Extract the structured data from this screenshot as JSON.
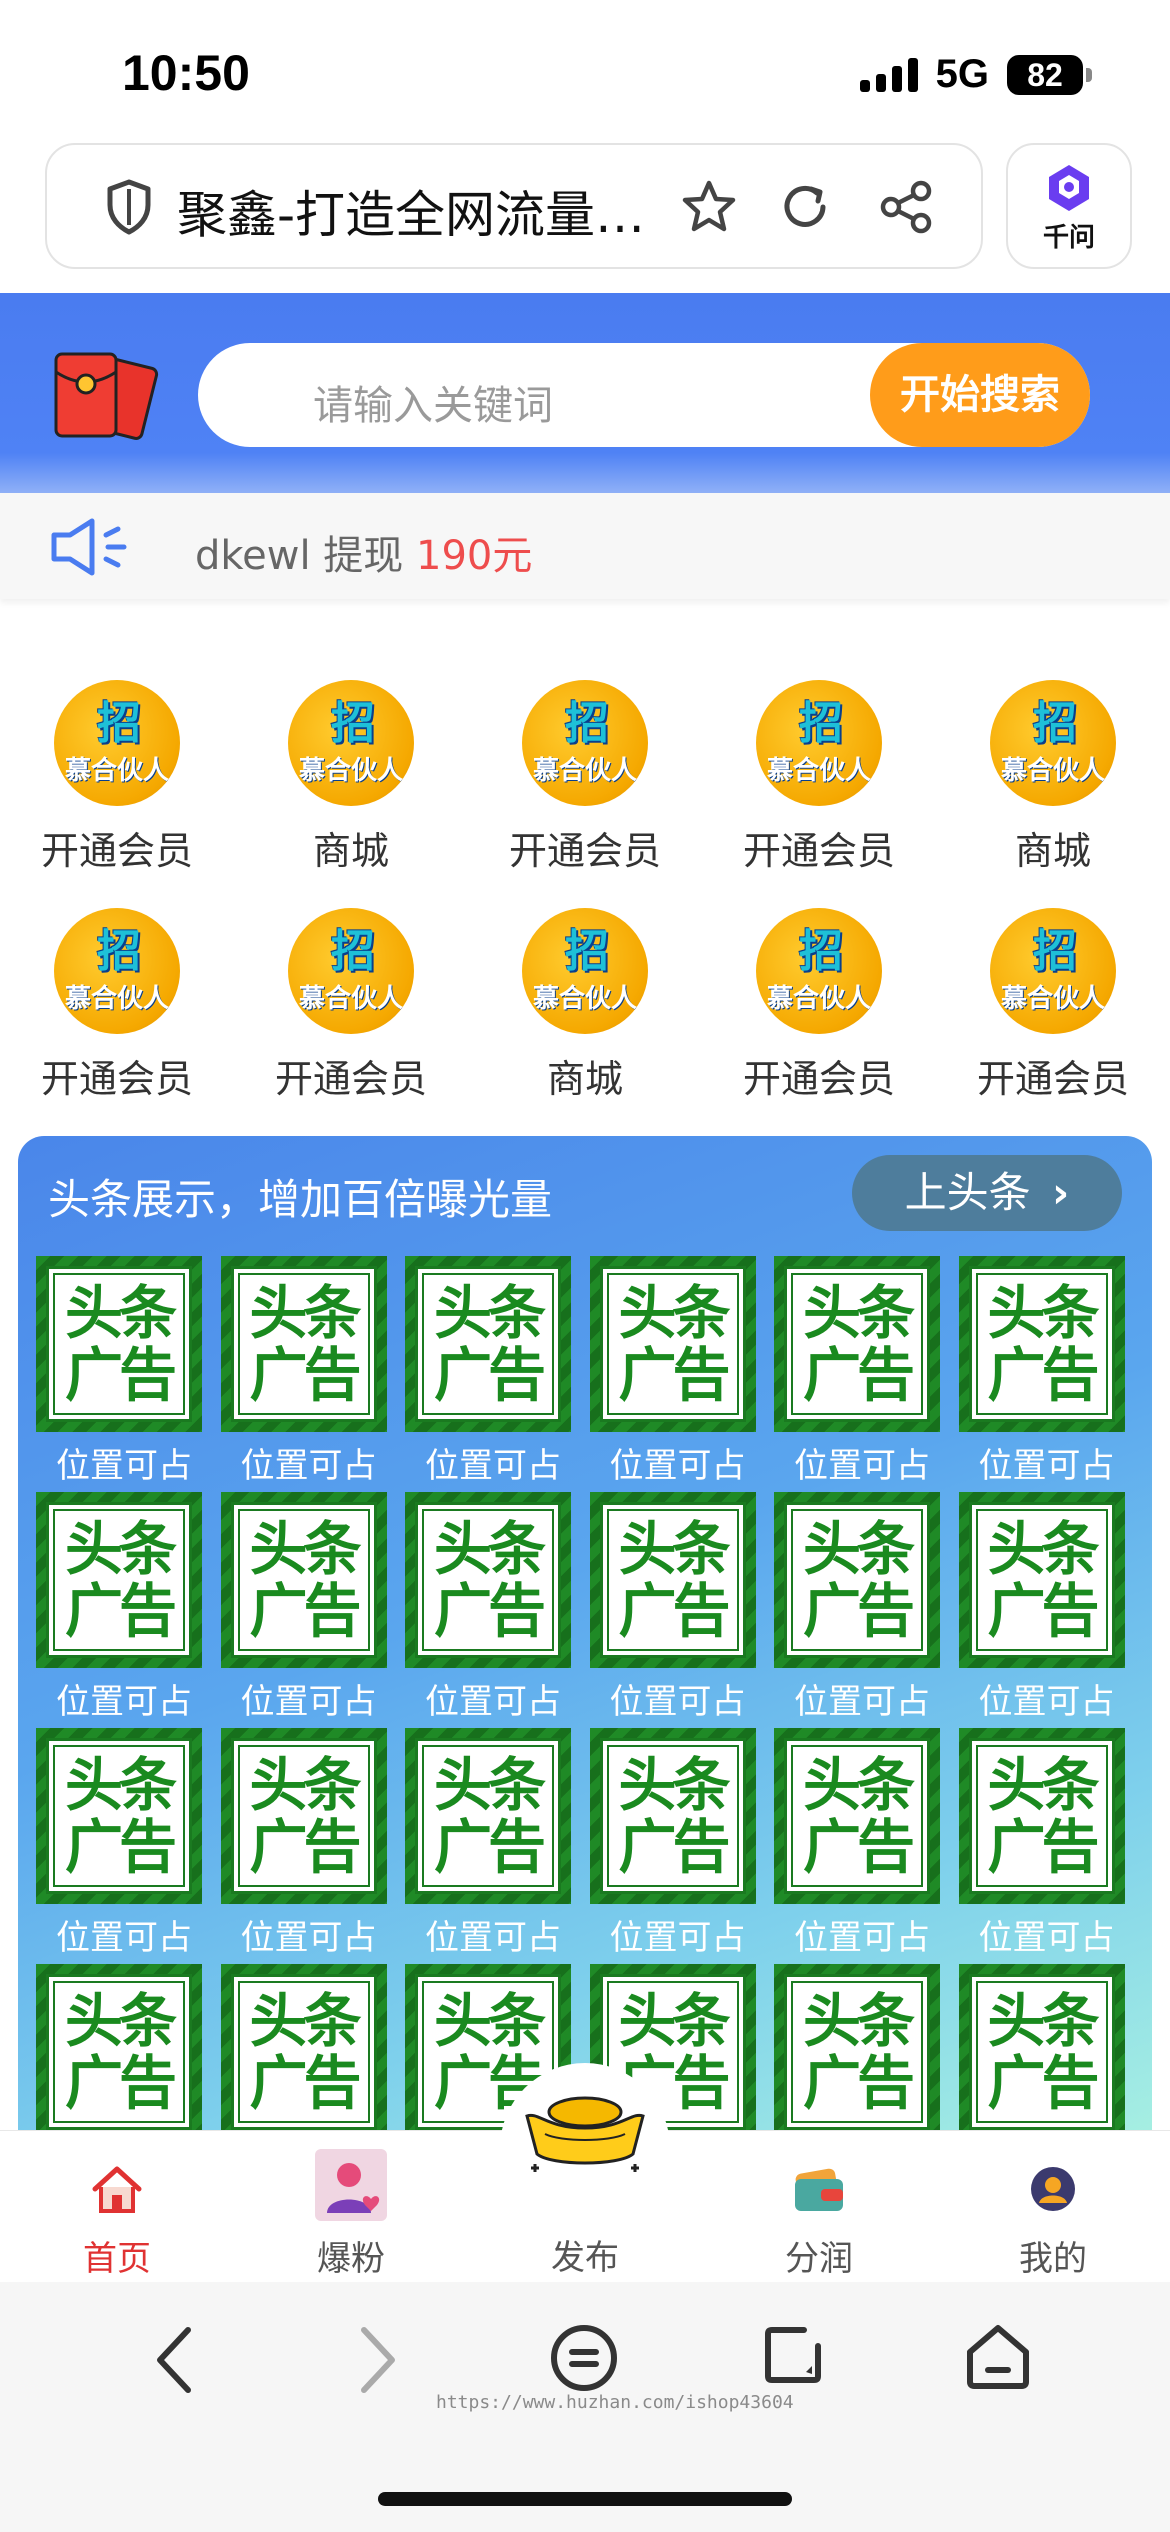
{
  "status_bar": {
    "time": "10:50",
    "network": "5G",
    "battery": "82"
  },
  "browser": {
    "page_title": "聚鑫-打造全网流量…",
    "assistant_label": "千问"
  },
  "search": {
    "placeholder": "请输入关键词",
    "button_label": "开始搜索"
  },
  "notice": {
    "user": "dkewl",
    "action": "提现",
    "amount": "190元"
  },
  "icon_grid": {
    "badge_main": "招",
    "badge_sub": "慕合伙人",
    "items": [
      {
        "label": "开通会员"
      },
      {
        "label": "商城"
      },
      {
        "label": "开通会员"
      },
      {
        "label": "开通会员"
      },
      {
        "label": "商城"
      },
      {
        "label": "开通会员"
      },
      {
        "label": "开通会员"
      },
      {
        "label": "商城"
      },
      {
        "label": "开通会员"
      },
      {
        "label": "开通会员"
      }
    ]
  },
  "headline": {
    "title": "头条展示，增加百倍曝光量",
    "button_label": "上头条",
    "ad_line1": "头条",
    "ad_line2": "广告",
    "slot_caption": "位置可占"
  },
  "tabbar": {
    "items": [
      {
        "label": "首页",
        "active": true
      },
      {
        "label": "爆粉",
        "active": false
      },
      {
        "label": "发布",
        "active": false
      },
      {
        "label": "分润",
        "active": false
      },
      {
        "label": "我的",
        "active": false
      }
    ]
  },
  "watermark": "https://www.huzhan.com/ishop43604",
  "colors": {
    "accent_blue": "#4a7cf0",
    "search_orange": "#ff9c1a",
    "active_red": "#e03232",
    "ad_green": "#1a8a1f"
  }
}
